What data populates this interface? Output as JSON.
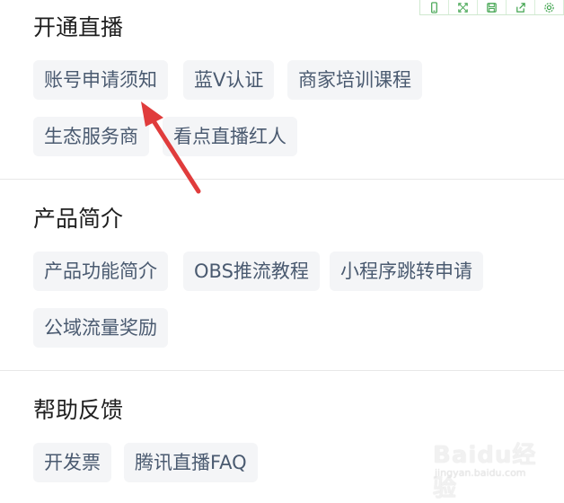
{
  "toolbar": {
    "icons": [
      "phone-icon",
      "expand-icon",
      "save-icon",
      "share-icon",
      "settings-icon"
    ]
  },
  "sections": [
    {
      "title": "开通直播",
      "tags": [
        "账号申请须知",
        "蓝V认证",
        "商家培训课程",
        "生态服务商",
        "看点直播红人"
      ]
    },
    {
      "title": "产品简介",
      "tags": [
        "产品功能简介",
        "OBS推流教程",
        "小程序跳转申请",
        "公域流量奖励"
      ]
    },
    {
      "title": "帮助反馈",
      "tags": [
        "开发票",
        "腾讯直播FAQ"
      ]
    }
  ],
  "watermark": {
    "brand": "Baidu经验",
    "url": "jingyan.baidu.com"
  },
  "colors": {
    "tag_bg": "#f4f5f7",
    "tag_text": "#4a5a70",
    "arrow": "#e03c3c",
    "toolbar_green": "#3fa34d"
  }
}
